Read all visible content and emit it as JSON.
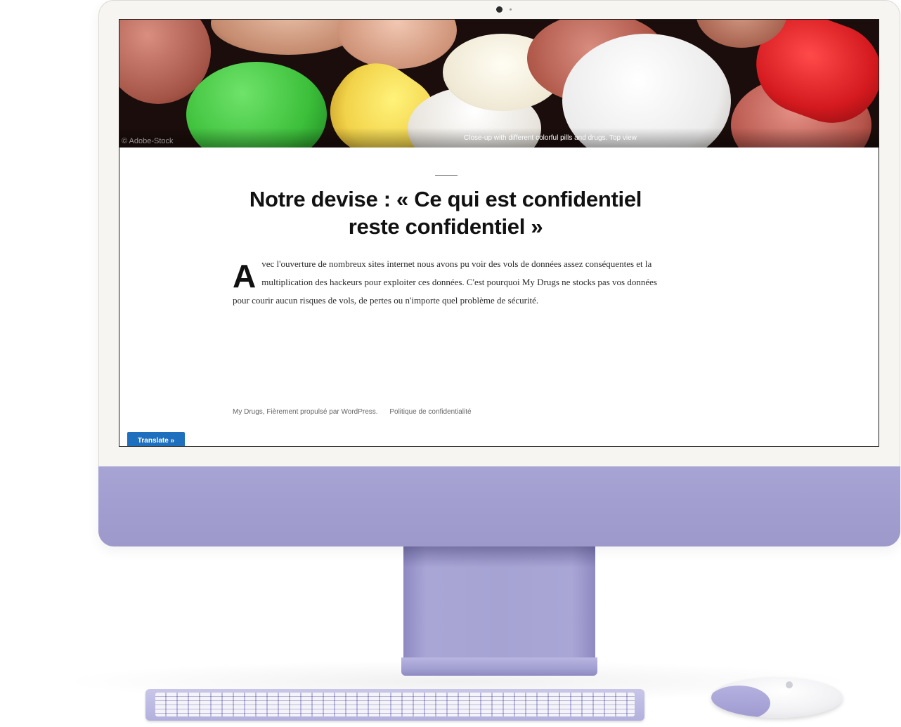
{
  "hero": {
    "image_alt": "Colorful pills and capsules background",
    "credit": "© Adobe-Stock",
    "caption": "Close-up with different colorful pills and drugs. Top view"
  },
  "article": {
    "title": "Notre devise : « Ce qui est confidentiel reste confidentiel »",
    "dropcap": "A",
    "body": "vec l'ouverture de nombreux sites internet nous avons pu voir des vols de données assez conséquentes et la multiplication des hackeurs pour exploiter ces données. C'est pourquoi My Drugs ne stocks pas vos données pour courir aucun risques de vols, de pertes ou n'importe quel problème de sécurité."
  },
  "footer": {
    "site_credit": "My Drugs, Fièrement propulsé par WordPress.",
    "privacy_link": "Politique de confidentialité"
  },
  "translate_button": "Translate »",
  "colors": {
    "imac_purple": "#a19dcf",
    "translate_blue": "#1f6fbf"
  }
}
